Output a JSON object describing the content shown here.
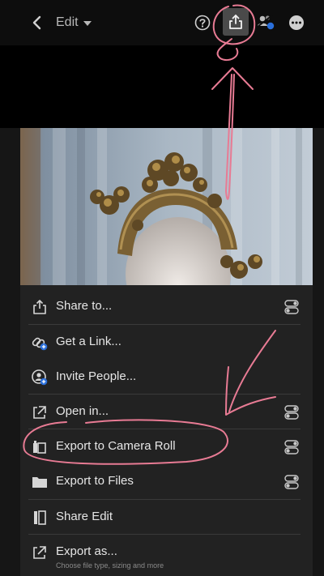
{
  "header": {
    "mode_label": "Edit",
    "icons": [
      "back-icon",
      "help-icon",
      "share-icon",
      "people-icon",
      "more-icon"
    ]
  },
  "menu": {
    "items": [
      {
        "label": "Share to...",
        "icon": "share-icon",
        "has_settings": true,
        "subtitle": ""
      },
      {
        "label": "Get a Link...",
        "icon": "link-icon",
        "has_settings": false,
        "subtitle": ""
      },
      {
        "label": "Invite People...",
        "icon": "invite-icon",
        "has_settings": false,
        "subtitle": ""
      },
      {
        "label": "Open in...",
        "icon": "open-in-icon",
        "has_settings": true,
        "subtitle": ""
      },
      {
        "label": "Export to Camera Roll",
        "icon": "camera-roll-icon",
        "has_settings": true,
        "subtitle": ""
      },
      {
        "label": "Export to Files",
        "icon": "folder-icon",
        "has_settings": true,
        "subtitle": ""
      },
      {
        "label": "Share Edit",
        "icon": "share-edit-icon",
        "has_settings": false,
        "subtitle": ""
      },
      {
        "label": "Export as...",
        "icon": "export-as-icon",
        "has_settings": false,
        "subtitle": "Choose file type, sizing and more"
      }
    ]
  },
  "colors": {
    "background": "#141414",
    "menu_background": "#222222",
    "annotation": "#e87b94",
    "badge_blue": "#2a6fdb"
  }
}
